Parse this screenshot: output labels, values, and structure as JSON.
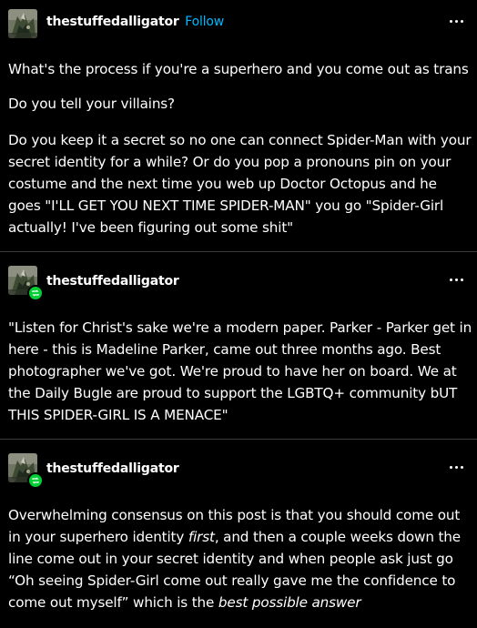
{
  "post1": {
    "username": "thestuffedalligator",
    "follow_label": "Follow",
    "paragraphs": [
      "What's the process if you're a superhero and you come out as trans",
      "Do you tell your villains?",
      "Do you keep it a secret so no one can connect Spider-Man with your secret identity for a while? Or do you pop a pronouns pin on your costume and the next time you web up Doctor Octopus and he goes \"I'LL GET YOU NEXT TIME SPIDER-MAN\" you go \"Spider-Girl actually! I've been figuring out some shit\""
    ]
  },
  "post2": {
    "username": "thestuffedalligator",
    "paragraph": "\"Listen for Christ's sake we're a modern paper. Parker - Parker get in here - this is Madeline Parker, came out three months ago. Best photographer we've got. We're proud to have her on board. We at the Daily Bugle are proud to support the LGBTQ+ community bUT THIS SPIDER-GIRL IS A MENACE\""
  },
  "post3": {
    "username": "thestuffedalligator",
    "text_a": "Overwhelming consensus on this post is that you should come out in your superhero identity ",
    "text_b": "first",
    "text_c": ", and then a couple weeks down the line come out in your secret identity and when people ask just go “Oh seeing Spider-Girl come out really gave me the confidence to come out myself” which is the ",
    "text_d": "best possible answer"
  },
  "icons": {
    "more": "ellipsis-icon",
    "reblog": "reblog-icon"
  },
  "colors": {
    "background": "#000000",
    "text": "#ffffff",
    "follow": "#00b8ff",
    "reblog_badge": "#00cf35",
    "divider": "#3a3a3a"
  }
}
